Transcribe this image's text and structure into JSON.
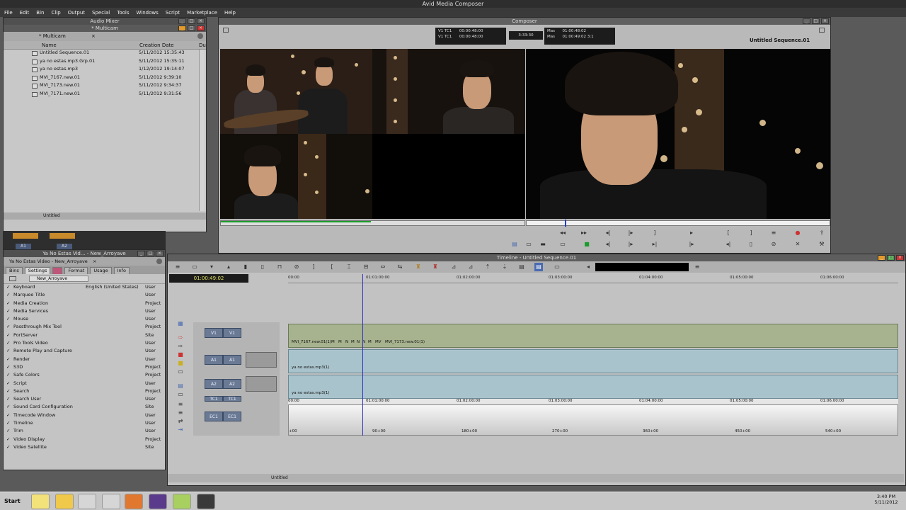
{
  "app": {
    "title": "Avid Media Composer",
    "menu": [
      "File",
      "Edit",
      "Bin",
      "Clip",
      "Output",
      "Special",
      "Tools",
      "Windows",
      "Script",
      "Marketplace",
      "Help"
    ]
  },
  "bin": {
    "window_title": "Audio Mixer",
    "tab_title": "* Multicam",
    "sub_tab": "* Multicam",
    "columns": {
      "name": "Name",
      "creation_date": "Creation Date",
      "duration": "Du"
    },
    "rows": [
      {
        "name": "Untitled Sequence.01",
        "date": "5/11/2012 15:35:43"
      },
      {
        "name": "ya no estas.mp3.Grp.01",
        "date": "5/11/2012 15:35:11"
      },
      {
        "name": "ya no estas.mp3",
        "date": "1/12/2012 19:14:07"
      },
      {
        "name": "MVI_7167.new.01",
        "date": "5/11/2012 9:39:10"
      },
      {
        "name": "MVI_7173.new.01",
        "date": "5/11/2012 9:34:37"
      },
      {
        "name": "MVI_7171.new.01",
        "date": "5/11/2012 9:31:56"
      }
    ],
    "footer_label": "Untitled"
  },
  "audio_strip": {
    "ch1": "A1",
    "ch2": "A2"
  },
  "project": {
    "window_title": "Ya No Estas Vid... - New_Arroyave",
    "inner_title": "Ya No Estas Video - New_Arroyave",
    "tabs": [
      "Bins",
      "Settings",
      "",
      "Format",
      "Usage",
      "Info"
    ],
    "user_select": "New_Arroyave",
    "settings": [
      {
        "name": "Keyboard",
        "value": "English (United States)",
        "kind": "User"
      },
      {
        "name": "Marquee Title",
        "value": "",
        "kind": "User"
      },
      {
        "name": "Media Creation",
        "value": "",
        "kind": "Project"
      },
      {
        "name": "Media Services",
        "value": "",
        "kind": "User"
      },
      {
        "name": "Mouse",
        "value": "",
        "kind": "User"
      },
      {
        "name": "Passthrough Mix Tool",
        "value": "",
        "kind": "Project"
      },
      {
        "name": "PortServer",
        "value": "",
        "kind": "Site"
      },
      {
        "name": "Pro Tools Video",
        "value": "",
        "kind": "User"
      },
      {
        "name": "Remote Play and Capture",
        "value": "",
        "kind": "User"
      },
      {
        "name": "Render",
        "value": "",
        "kind": "User"
      },
      {
        "name": "S3D",
        "value": "",
        "kind": "Project"
      },
      {
        "name": "Safe Colors",
        "value": "",
        "kind": "Project"
      },
      {
        "name": "Script",
        "value": "",
        "kind": "User"
      },
      {
        "name": "Search",
        "value": "",
        "kind": "Project"
      },
      {
        "name": "Search User",
        "value": "",
        "kind": "User"
      },
      {
        "name": "Sound Card Configuration",
        "value": "",
        "kind": "Site"
      },
      {
        "name": "Timecode Window",
        "value": "",
        "kind": "User"
      },
      {
        "name": "Timeline",
        "value": "",
        "kind": "User"
      },
      {
        "name": "Trim",
        "value": "",
        "kind": "User"
      },
      {
        "name": "Video Display",
        "value": "",
        "kind": "Project"
      },
      {
        "name": "Video Satellite",
        "value": "",
        "kind": "Site"
      }
    ]
  },
  "composer": {
    "title": "Composer",
    "sequence_name": "Untitled Sequence.01",
    "tc_left": [
      {
        "label": "V1 TC1",
        "value": "00:00:48:00"
      },
      {
        "label": "V1 TC1",
        "value": "00:00:48:00"
      }
    ],
    "center_value": "3:33:30",
    "tc_right": [
      {
        "label": "Mas",
        "value": "01:00:48:02"
      },
      {
        "label": "Mas",
        "value": "01:00:49:02 3:1"
      }
    ]
  },
  "timeline": {
    "title": "Timeline - Untitled Sequence.01",
    "position_tc": "01:00:49:02",
    "ruler_ticks": [
      "00:00",
      "01:01:00:00",
      "01:02:00:00",
      "01:03:00:00",
      "01:04:00:00",
      "01:05:00:00",
      "01:06:00:00"
    ],
    "tracks": {
      "v1": {
        "label": "V1",
        "clips": [
          "MVI_7167.new.01(1)",
          "M",
          "M",
          "N",
          "M",
          "N",
          "N",
          "M",
          "MV",
          "MVI_7173.new.01(1)"
        ]
      },
      "a1": {
        "label": "A1",
        "clip": "ya no estas.mp3(1)"
      },
      "a2": {
        "label": "A2",
        "clip": "ya no estas.mp3(1)"
      },
      "tc1": {
        "label": "TC1",
        "ticks": [
          "00:00",
          "01:01:00:00",
          "01:02:00:00",
          "01:03:00:00",
          "01:04:00:00",
          "01:05:00:00",
          "01:06:00:00"
        ]
      },
      "ec1": {
        "label": "EC1",
        "ticks": [
          "+00",
          "90+00",
          "180+00",
          "270+00",
          "360+00",
          "450+00",
          "540+00"
        ]
      }
    },
    "footer_label": "Untitled"
  },
  "taskbar": {
    "start_label": "Start",
    "clock_time": "3:40 PM",
    "clock_date": "5/11/2012"
  }
}
